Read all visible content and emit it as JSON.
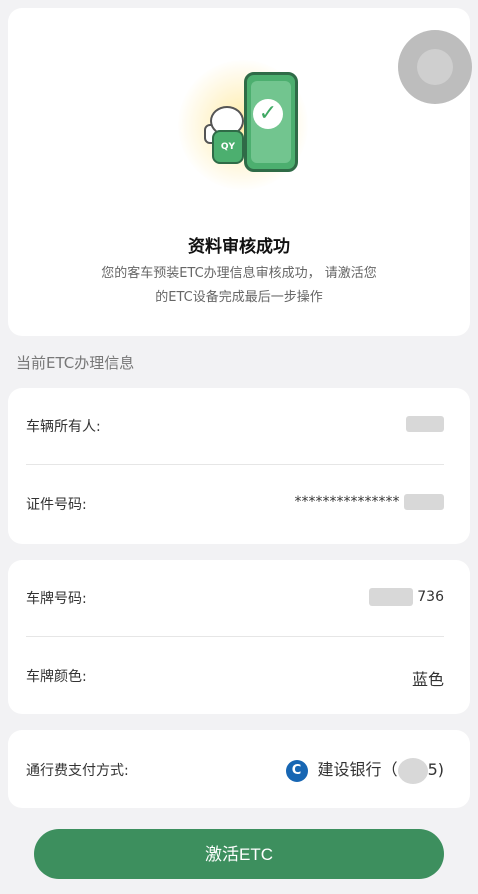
{
  "status": {
    "title": "资料审核成功",
    "desc_line1": "您的客车预装ETC办理信息审核成功， 请激活您",
    "desc_line2": "的ETC设备完成最后一步操作",
    "mascot_badge": "QY"
  },
  "section_title": "当前ETC办理信息",
  "owner_group": {
    "owner_label": "车辆所有人:",
    "id_label": "证件号码:",
    "id_value": "***************"
  },
  "plate_group": {
    "plate_label": "车牌号码:",
    "plate_suffix": "736",
    "color_label": "车牌颜色:",
    "color_value": "蓝色"
  },
  "payment": {
    "label": "通行费支付方式:",
    "bank_name": "建设银行",
    "card_prefix": "（",
    "card_suffix": "5)"
  },
  "activate_button": "激活ETC",
  "colors": {
    "primary_green": "#3d8f5e",
    "bank_blue": "#1766b3"
  }
}
